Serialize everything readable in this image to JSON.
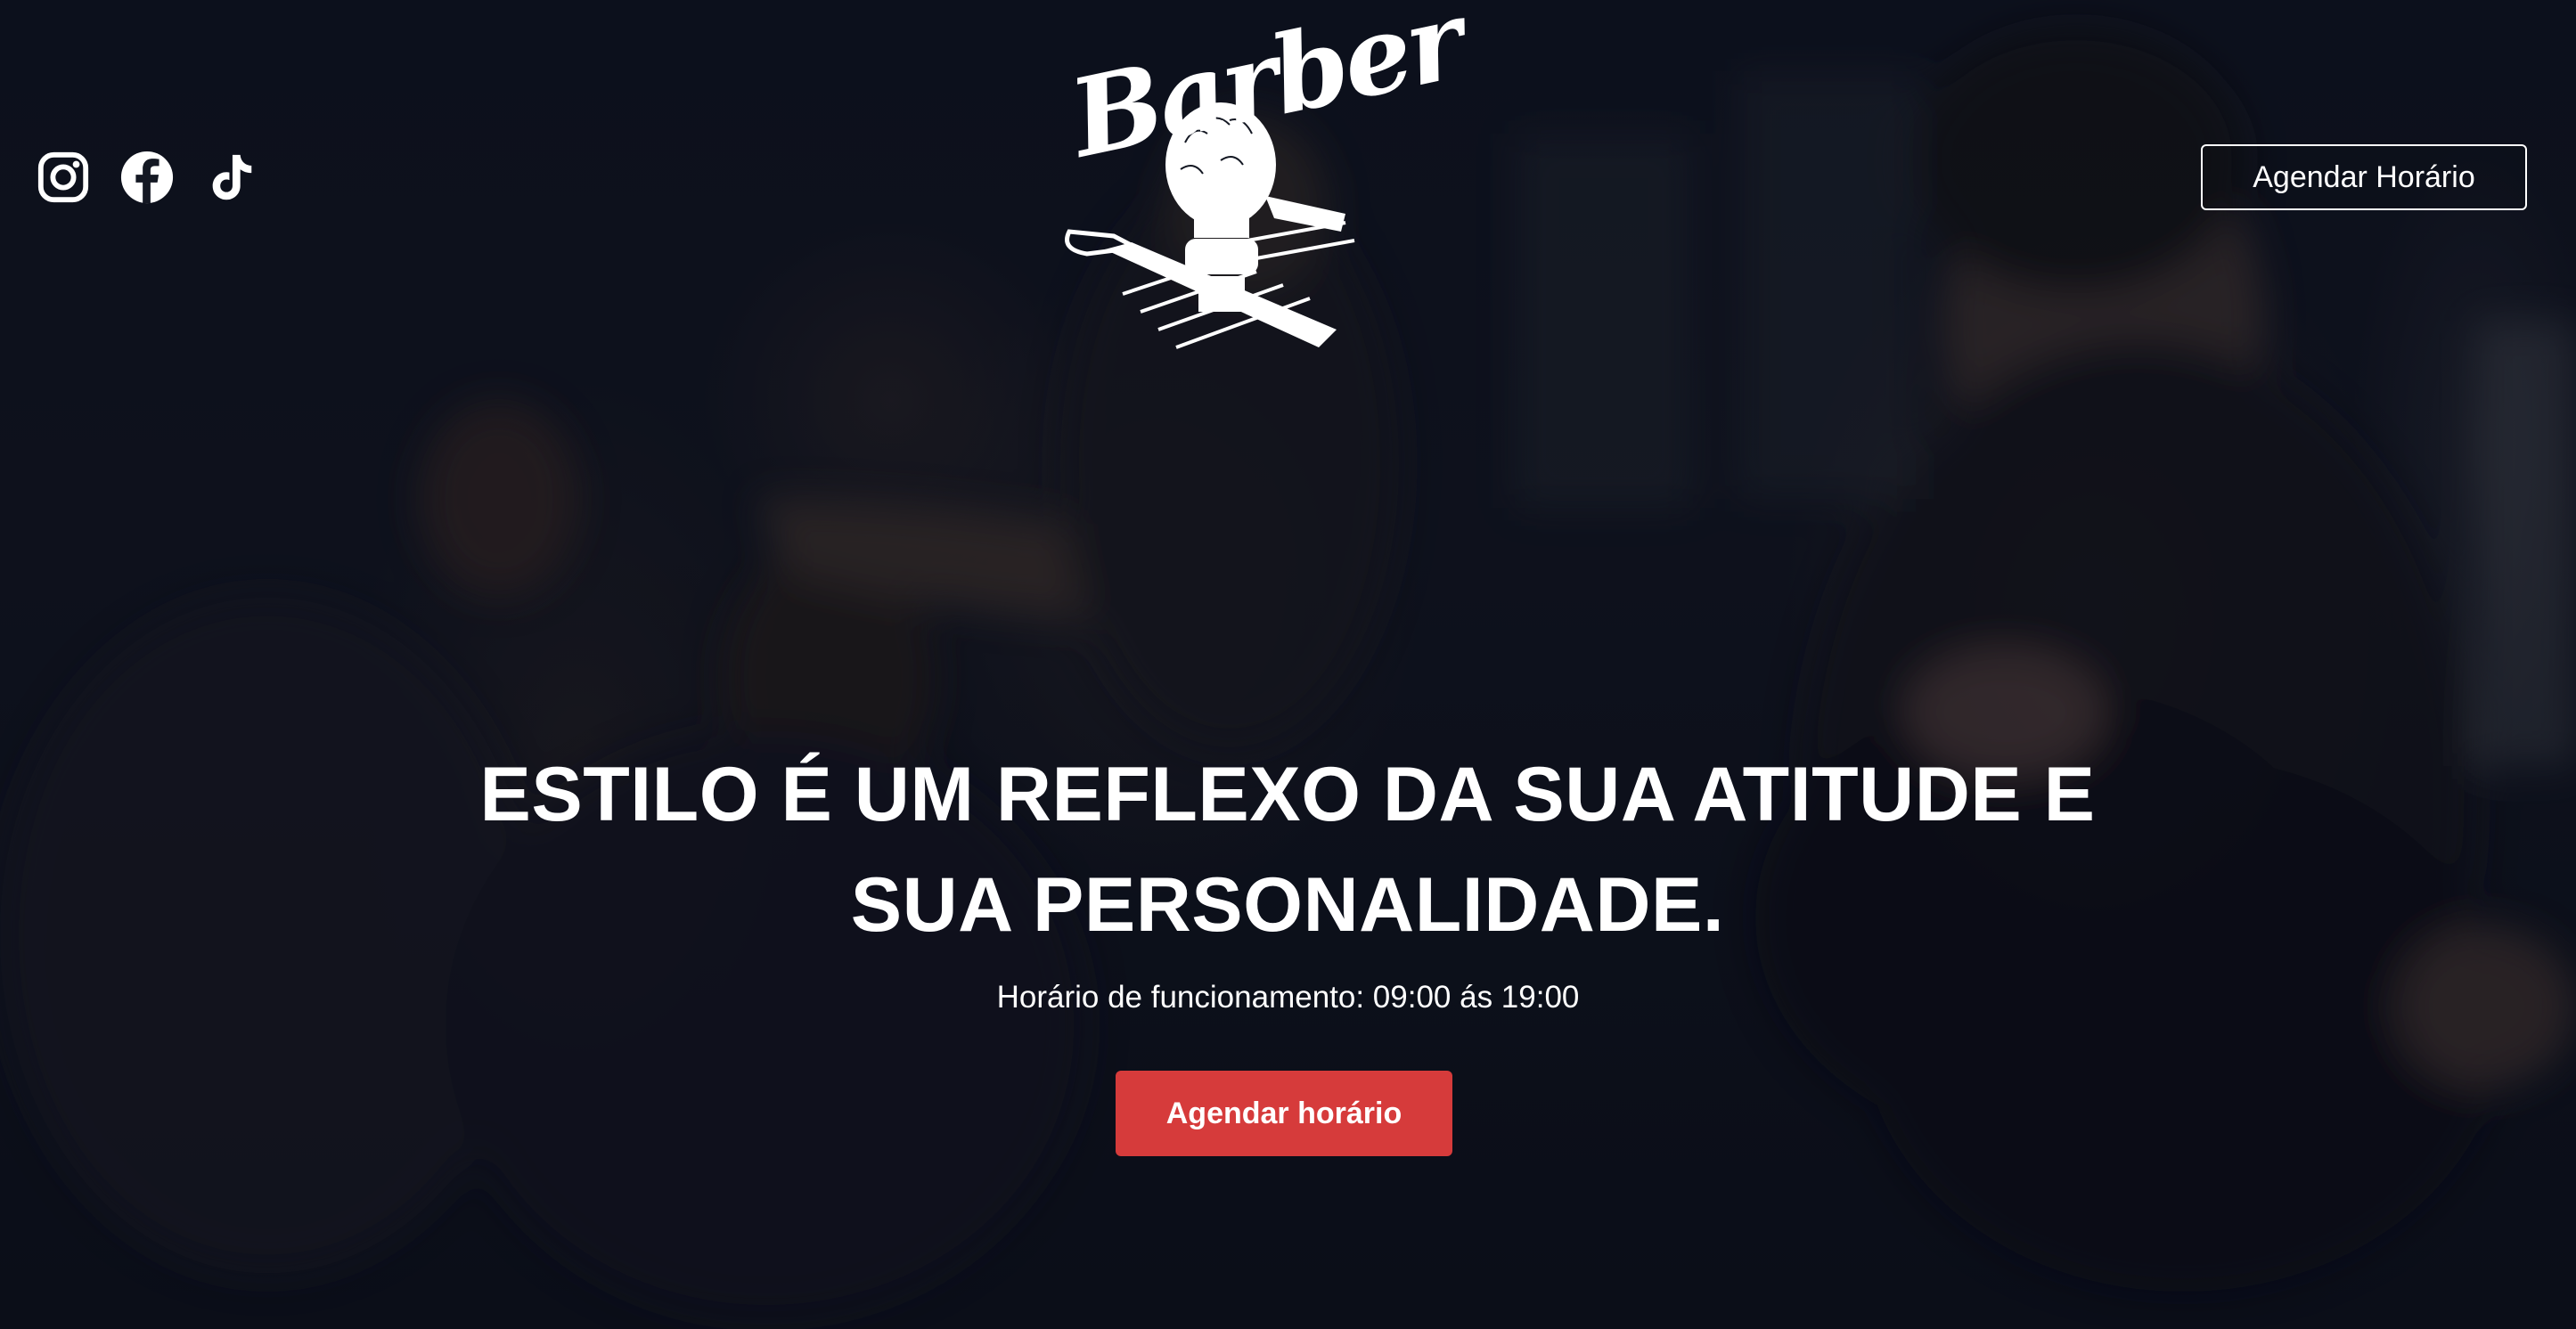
{
  "brand": {
    "logo_text": "Barber"
  },
  "header": {
    "social_icons": [
      "instagram-icon",
      "facebook-icon",
      "tiktok-icon"
    ],
    "cta_label": "Agendar Horário"
  },
  "hero": {
    "headline_line1": "ESTILO É UM REFLEXO DA SUA ATITUDE E",
    "headline_line2": "SUA PERSONALIDADE.",
    "hours_text": "Horário de funcionamento: 09:00 ás 19:00",
    "cta_label": "Agendar horário"
  },
  "colors": {
    "accent": "#d63b3b",
    "text": "#ffffff",
    "background": "#0b0f18"
  }
}
